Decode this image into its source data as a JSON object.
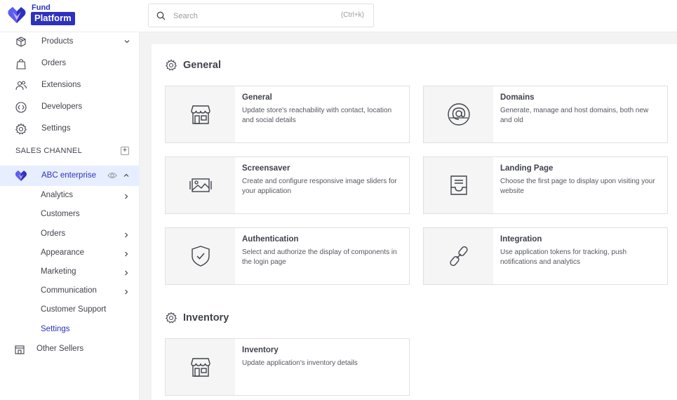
{
  "brand": {
    "line1": "Fund",
    "line2": "Platform",
    "accent": "#2e31be"
  },
  "search": {
    "placeholder": "Search",
    "shortcut": "(Ctrl+k)"
  },
  "sidebar": {
    "items": [
      {
        "label": "Products",
        "icon": "box-icon"
      },
      {
        "label": "Orders",
        "icon": "bag-icon"
      },
      {
        "label": "Extensions",
        "icon": "users-icon"
      },
      {
        "label": "Developers",
        "icon": "code-icon"
      },
      {
        "label": "Settings",
        "icon": "gear-icon"
      }
    ],
    "section_header": "SALES CHANNEL",
    "channel": {
      "label": "ABC enterprise"
    },
    "sub_items": [
      {
        "label": "Analytics"
      },
      {
        "label": "Customers"
      },
      {
        "label": "Orders"
      },
      {
        "label": "Appearance"
      },
      {
        "label": "Marketing"
      },
      {
        "label": "Communication"
      },
      {
        "label": "Customer Support"
      },
      {
        "label": "Settings"
      }
    ],
    "other_sellers": {
      "label": "Other Sellers"
    }
  },
  "main": {
    "general_title": "General",
    "cards": [
      {
        "title": "General",
        "desc": "Update store's reachability with contact, location and social details",
        "icon": "store-icon"
      },
      {
        "title": "Domains",
        "desc": "Generate, manage and host domains, both new and old",
        "icon": "at-sign-icon"
      },
      {
        "title": "Screensaver",
        "desc": "Create and configure responsive image sliders for your application",
        "icon": "image-slider-icon"
      },
      {
        "title": "Landing Page",
        "desc": "Choose the first page to display upon visiting your website",
        "icon": "inbox-icon"
      },
      {
        "title": "Authentication",
        "desc": "Select and authorize the display of components in the login page",
        "icon": "shield-check-icon"
      },
      {
        "title": "Integration",
        "desc": "Use application tokens for tracking, push notifications and analytics",
        "icon": "link-icon"
      }
    ],
    "inventory_title": "Inventory",
    "inventory_card": {
      "title": "Inventory",
      "desc": "Update application's inventory details",
      "icon": "store-icon"
    }
  }
}
